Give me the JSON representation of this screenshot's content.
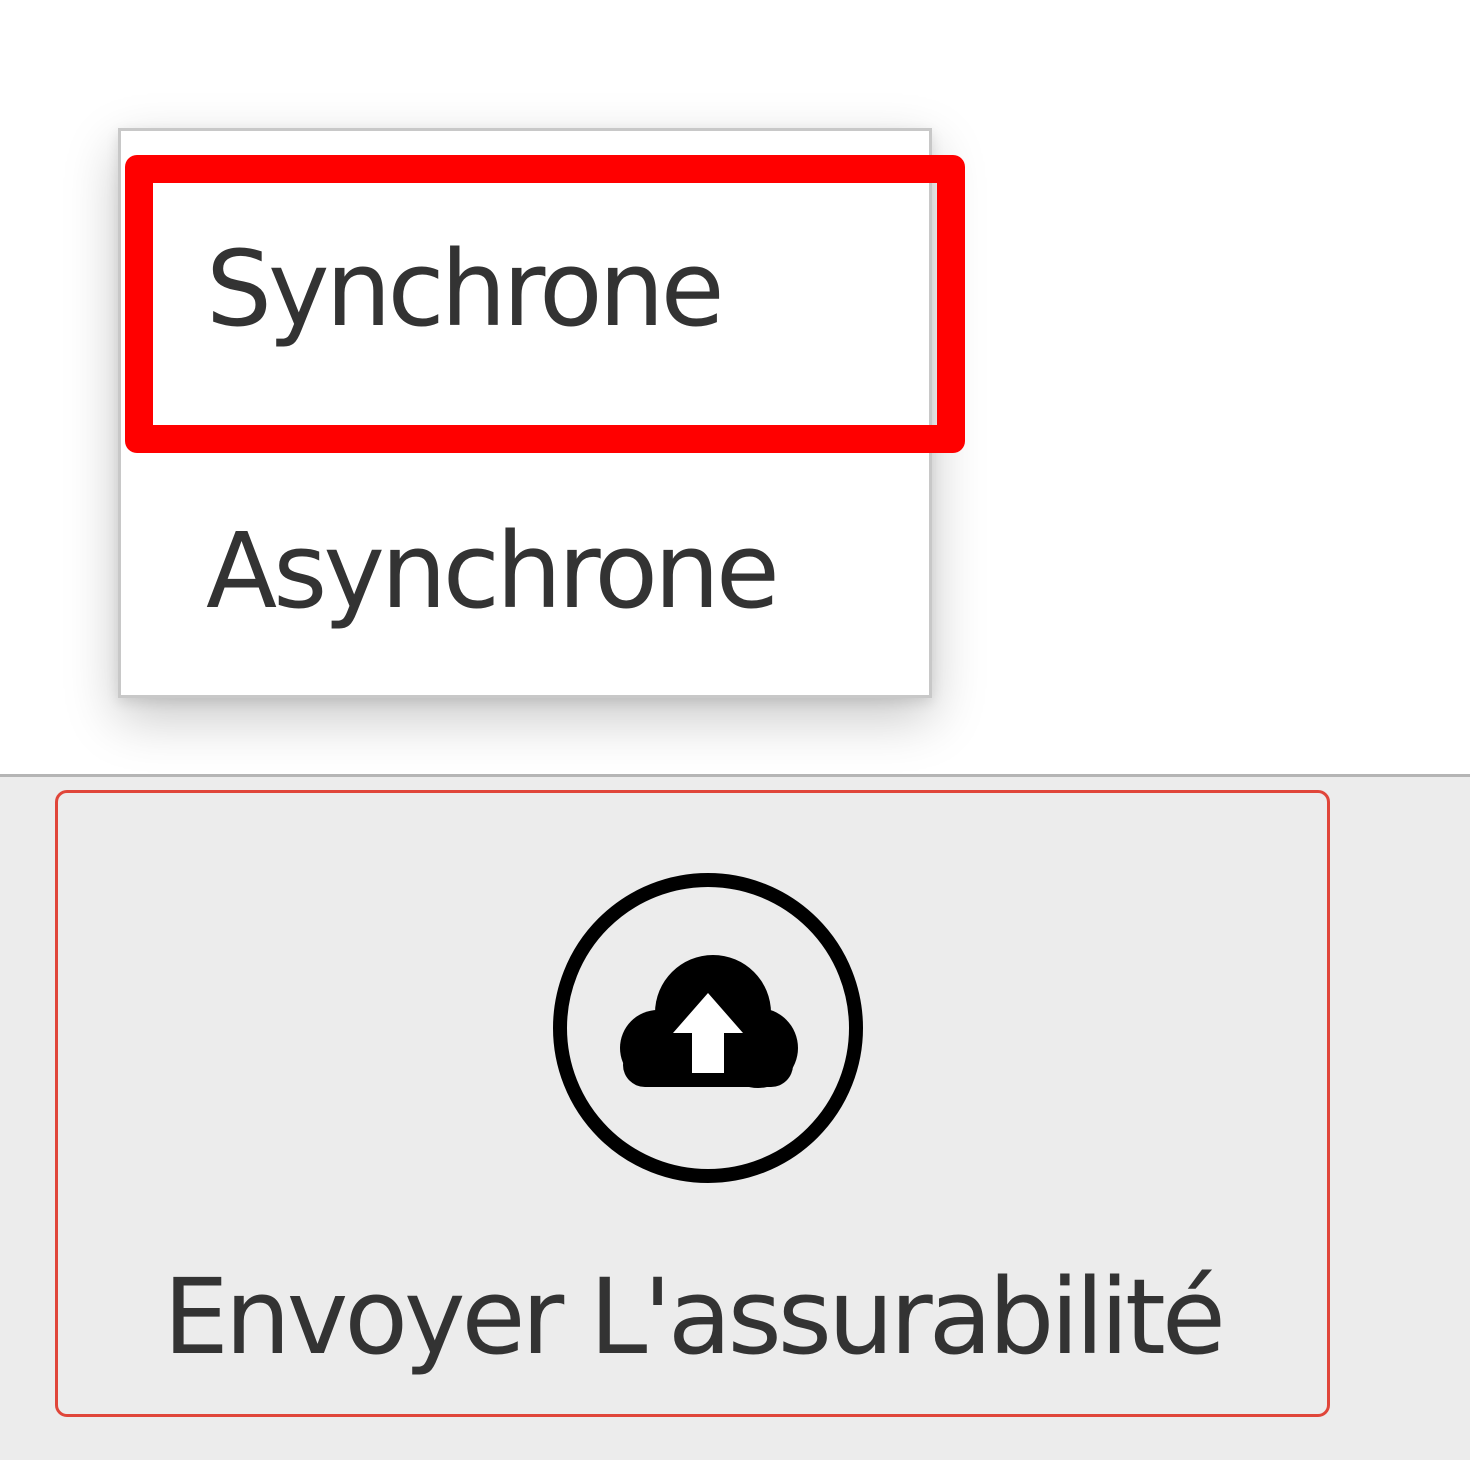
{
  "dropdown": {
    "items": [
      {
        "label": "Synchrone",
        "highlighted": true
      },
      {
        "label": "Asynchrone",
        "highlighted": false
      }
    ],
    "highlight_color": "#ff0000"
  },
  "toolbar": {
    "send_button": {
      "label": "Envoyer L'assurabilité",
      "icon": "cloud-upload-icon",
      "border_color": "#e0463a"
    },
    "background_color": "#ececec"
  }
}
